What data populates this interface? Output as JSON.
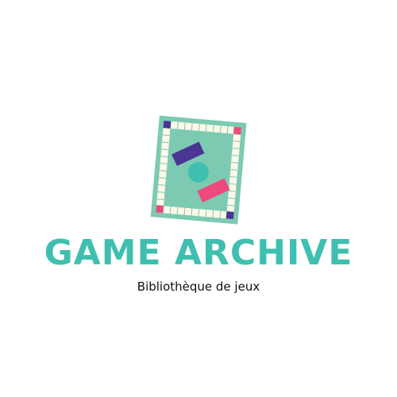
{
  "logo": {
    "title": "GAME ARCHIVE",
    "subtitle": "Bibliothèque de jeux",
    "icon": "board-game-icon"
  },
  "colors": {
    "board_outer": "#7ccab2",
    "board_inner": "#7ccab2",
    "track": "#fdf8e8",
    "teal": "#3fbfaf",
    "purple": "#4a3594",
    "pink": "#ee4a7c",
    "title": "#3fbfaf",
    "subtitle": "#111111"
  }
}
